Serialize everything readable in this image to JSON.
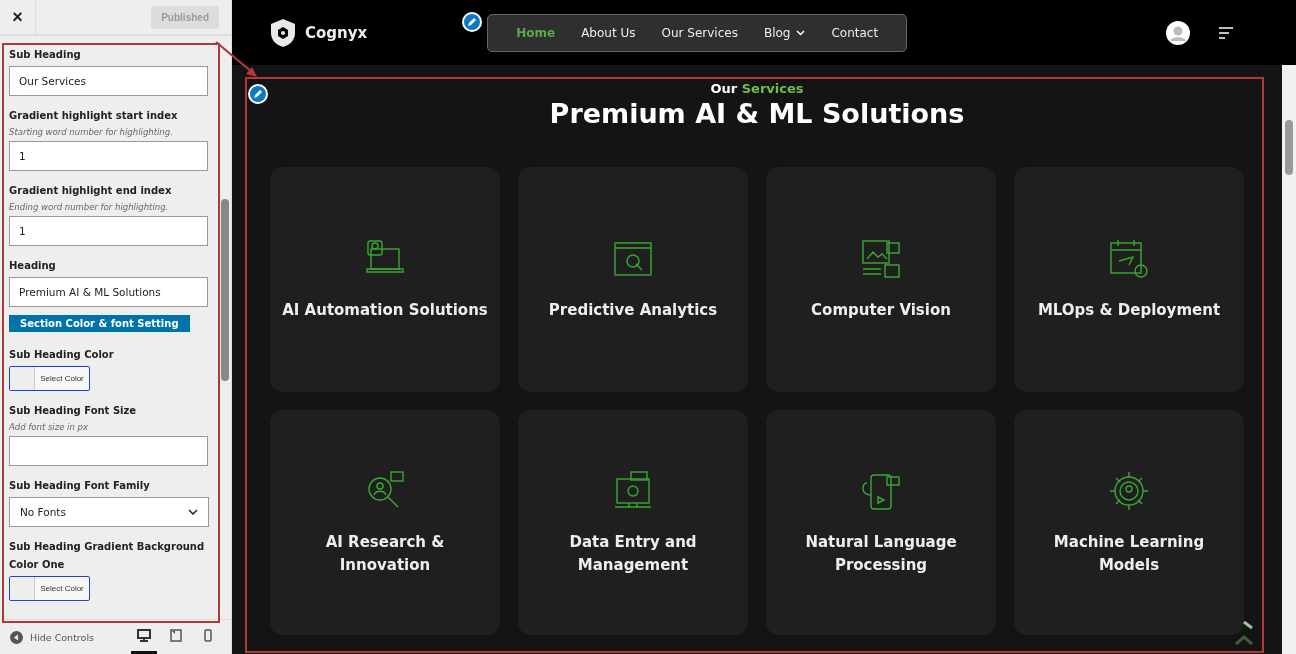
{
  "sidebar": {
    "close": "×",
    "publish_button": "Published",
    "fields": [
      {
        "kind": "text",
        "label": "Sub Heading",
        "value": "Our Services"
      },
      {
        "kind": "text",
        "label": "Gradient highlight start index",
        "description": "Starting word number for highlighting.",
        "value": "1"
      },
      {
        "kind": "text",
        "label": "Gradient highlight end index",
        "description": "Ending word number for highlighting.",
        "value": "1"
      },
      {
        "kind": "text",
        "label": "Heading",
        "value": "Premium AI & ML Solutions"
      },
      {
        "kind": "section",
        "label": "Section Color & font Setting"
      },
      {
        "kind": "color",
        "label": "Sub Heading Color",
        "button": "Select Color"
      },
      {
        "kind": "text",
        "label": "Sub Heading Font Size",
        "description": "Add font size in px"
      },
      {
        "kind": "select",
        "label": "Sub Heading Font Family",
        "value": "No Fonts"
      },
      {
        "kind": "color",
        "label": "Sub Heading Gradient Background Color One",
        "button": "Select Color"
      }
    ],
    "footer": {
      "hide_controls": "Hide Controls",
      "devices": [
        {
          "kind": "desktop",
          "selected": true
        },
        {
          "kind": "tablet",
          "selected": false
        },
        {
          "kind": "mobile",
          "selected": false
        }
      ]
    }
  },
  "site": {
    "logo": "Cognyx",
    "nav": [
      {
        "label": "Home",
        "selected": true,
        "dropdown": false
      },
      {
        "label": "About Us",
        "selected": false,
        "dropdown": false
      },
      {
        "label": "Our Services",
        "selected": false,
        "dropdown": false
      },
      {
        "label": "Blog",
        "selected": false,
        "dropdown": true
      },
      {
        "label": "Contact",
        "selected": false,
        "dropdown": false
      }
    ],
    "subheading": [
      {
        "text": "Our",
        "highlight": false
      },
      {
        "text": "Services",
        "highlight": true
      }
    ],
    "heading": "Premium AI & ML Solutions",
    "cards": [
      {
        "kind": "laptop",
        "title": "AI Automation Solutions"
      },
      {
        "kind": "window",
        "title": "Predictive Analytics"
      },
      {
        "kind": "media",
        "title": "Computer Vision"
      },
      {
        "kind": "calendar",
        "title": "MLOps & Deployment"
      },
      {
        "kind": "search",
        "title": "AI Research & Innovation"
      },
      {
        "kind": "monitor",
        "title": "Data Entry and Management"
      },
      {
        "kind": "phone",
        "title": "Natural Language Processing"
      },
      {
        "kind": "gear",
        "title": "Machine Learning Models"
      }
    ]
  }
}
